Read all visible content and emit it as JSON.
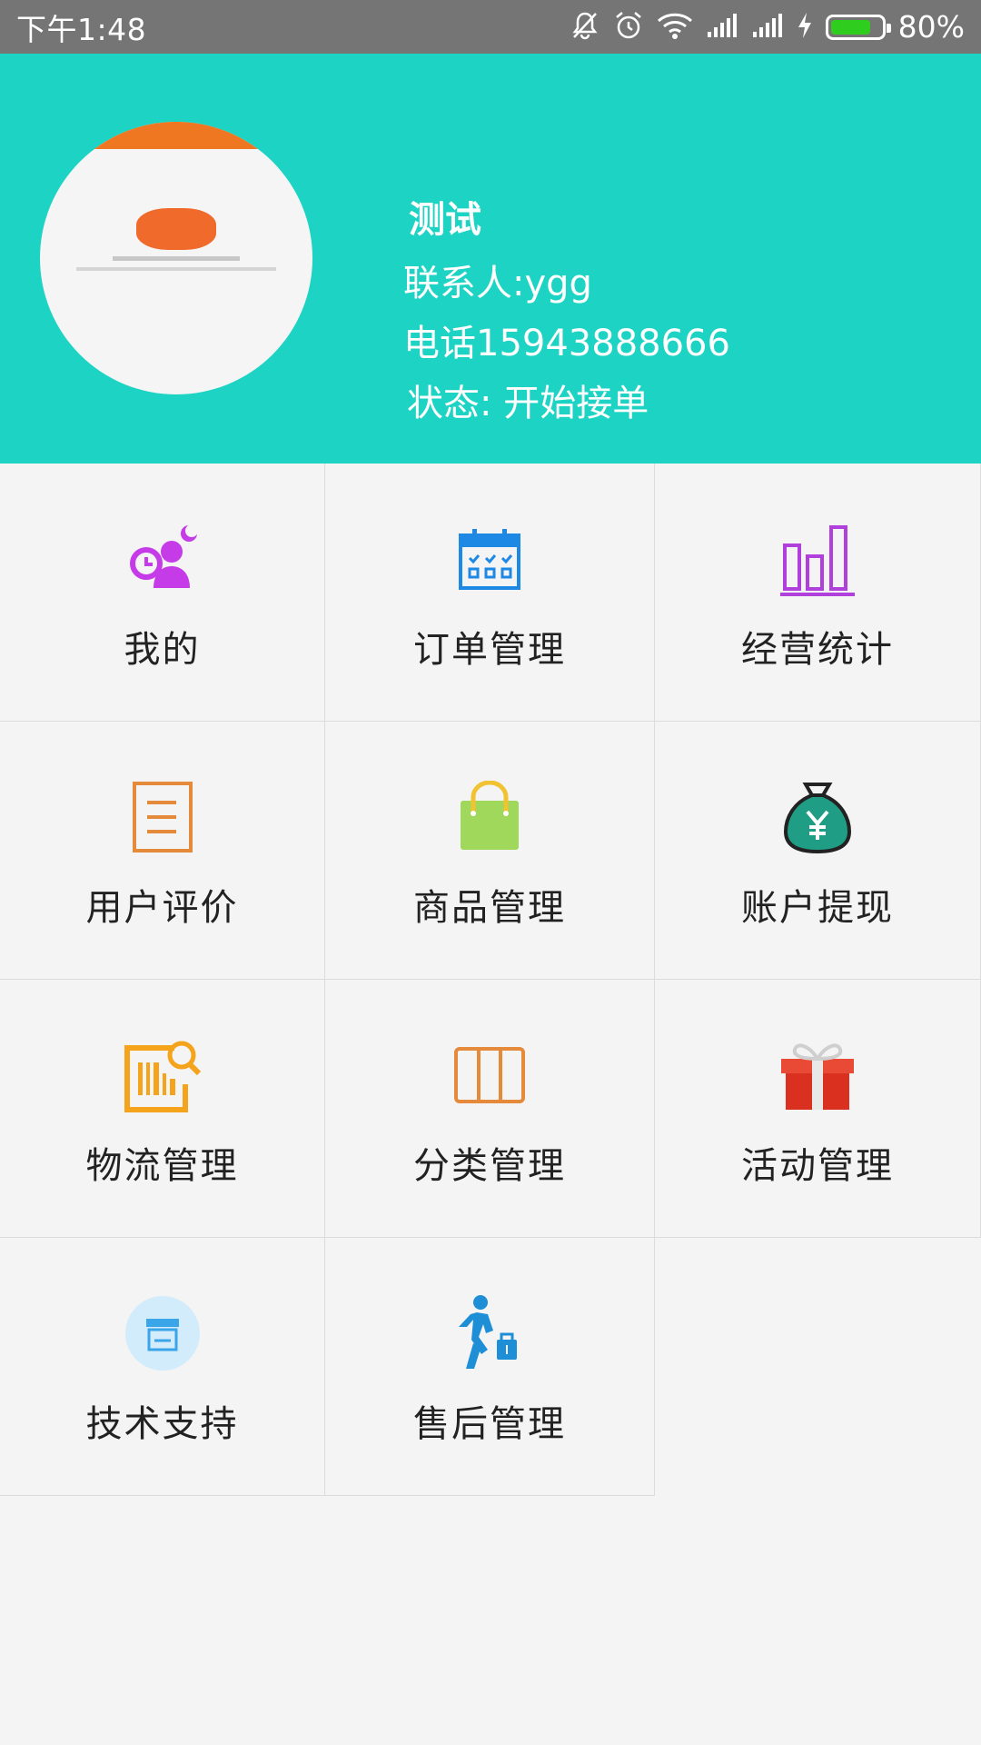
{
  "status_bar": {
    "time": "下午1:48",
    "battery_percent": "80%",
    "battery_level": 0.8,
    "icons": [
      "bell-off-icon",
      "alarm-icon",
      "wifi-icon",
      "signal-icon",
      "signal-icon",
      "charging-icon",
      "battery-icon"
    ]
  },
  "header": {
    "background": "#1dd3c4",
    "store_name": "测试",
    "contact": "联系人:ygg",
    "phone": "电话15943888666",
    "status": "状态:  开始接单"
  },
  "menu": [
    {
      "label": "我的",
      "icon": "user-profile-icon",
      "color": "#c63be8"
    },
    {
      "label": "订单管理",
      "icon": "calendar-icon",
      "color": "#1e88e5"
    },
    {
      "label": "经营统计",
      "icon": "bar-chart-icon",
      "color": "#b03fdc"
    },
    {
      "label": "用户评价",
      "icon": "document-icon",
      "color": "#e58a3a"
    },
    {
      "label": "商品管理",
      "icon": "shopping-bag-icon",
      "color": "#9fd85a"
    },
    {
      "label": "账户提现",
      "icon": "money-bag-icon",
      "color": "#1f9e85"
    },
    {
      "label": "物流管理",
      "icon": "barcode-search-icon",
      "color": "#f5a31a"
    },
    {
      "label": "分类管理",
      "icon": "columns-icon",
      "color": "#e58a3a"
    },
    {
      "label": "活动管理",
      "icon": "gift-icon",
      "color": "#e03a2a"
    },
    {
      "label": "技术支持",
      "icon": "store-icon",
      "color": "#3aa5e8"
    },
    {
      "label": "售后管理",
      "icon": "walking-person-icon",
      "color": "#1e8fd6"
    }
  ]
}
